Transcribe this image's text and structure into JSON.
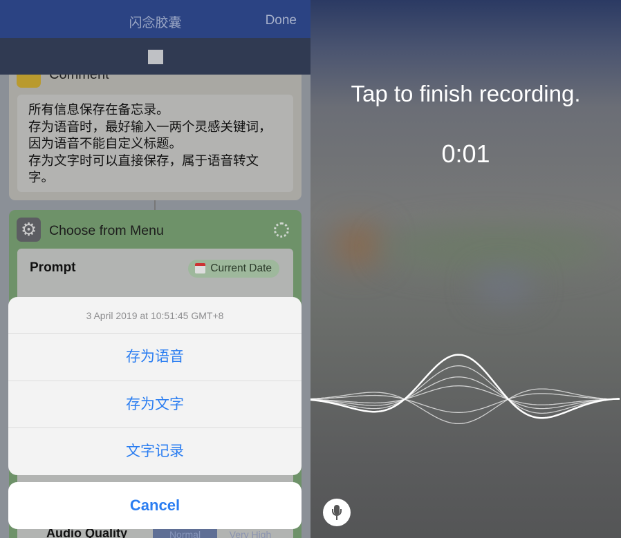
{
  "left": {
    "nav": {
      "title": "闪念胶囊",
      "done_label": "Done"
    },
    "comment": {
      "title": "Comment",
      "text": "所有信息保存在备忘录。\n存为语音时，最好输入一两个灵感关键词，因为语音不能自定义标题。\n存为文字时可以直接保存，属于语音转文字。"
    },
    "menu_action": {
      "title": "Choose from Menu",
      "prompt_label": "Prompt",
      "prompt_value": "Current Date"
    },
    "audio": {
      "label": "Audio Quality",
      "options": [
        "Normal",
        "Very High"
      ],
      "selected": "Normal"
    },
    "action_sheet": {
      "header": "3 April 2019 at 10:51:45 GMT+8",
      "options": [
        "存为语音",
        "存为文字",
        "文字记录"
      ],
      "cancel_label": "Cancel"
    }
  },
  "right": {
    "instruction": "Tap to finish recording.",
    "timer": "0:01",
    "icon": "microphone-icon"
  }
}
